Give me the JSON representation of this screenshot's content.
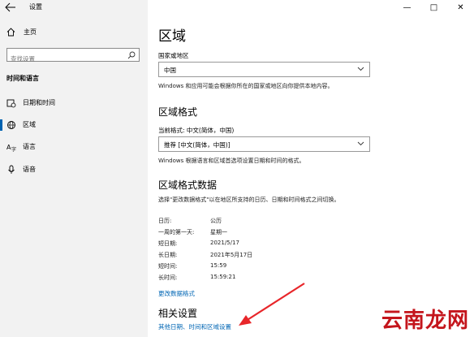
{
  "window": {
    "title": "设置",
    "controls": {
      "minimize": "—",
      "maximize": "□",
      "close": "✕"
    }
  },
  "sidebar": {
    "home_label": "主页",
    "search_placeholder": "查找设置",
    "section_header": "时间和语言",
    "items": [
      {
        "label": "日期和时间",
        "icon": "calendar-clock-icon",
        "active": false
      },
      {
        "label": "区域",
        "icon": "globe-icon",
        "active": true
      },
      {
        "label": "语言",
        "icon": "language-icon",
        "active": false
      },
      {
        "label": "语音",
        "icon": "microphone-icon",
        "active": false
      }
    ]
  },
  "main": {
    "title": "区域",
    "country": {
      "label": "国家或地区",
      "value": "中国",
      "description": "Windows 和应用可能会根据你所在的国家或地区向你提供本地内容。"
    },
    "format": {
      "heading": "区域格式",
      "current_label": "当前格式: 中文(简体，中国)",
      "value": "推荐 [中文(简体，中国)]",
      "description": "Windows 根据语言和区域首选项设置日期和时间的格式。"
    },
    "format_data": {
      "heading": "区域格式数据",
      "description": "选择\"更改数据格式\"以在地区所支持的日历、日期和时间格式之间切换。",
      "rows": [
        {
          "key": "日历:",
          "value": "公历"
        },
        {
          "key": "一周的第一天:",
          "value": "星期一"
        },
        {
          "key": "短日期:",
          "value": "2021/5/17"
        },
        {
          "key": "长日期:",
          "value": "2021年5月17日"
        },
        {
          "key": "短时间:",
          "value": "15:59"
        },
        {
          "key": "长时间:",
          "value": "15:59:21"
        }
      ],
      "change_link": "更改数据格式"
    },
    "related": {
      "heading": "相关设置",
      "link": "其他日期、时间和区域设置"
    }
  },
  "annotation": {
    "arrow_color": "#e8262a"
  },
  "watermark": "云南龙网",
  "colors": {
    "accent": "#0063b1",
    "link": "#0066b4",
    "sidebar_bg": "#f2f2f2"
  }
}
